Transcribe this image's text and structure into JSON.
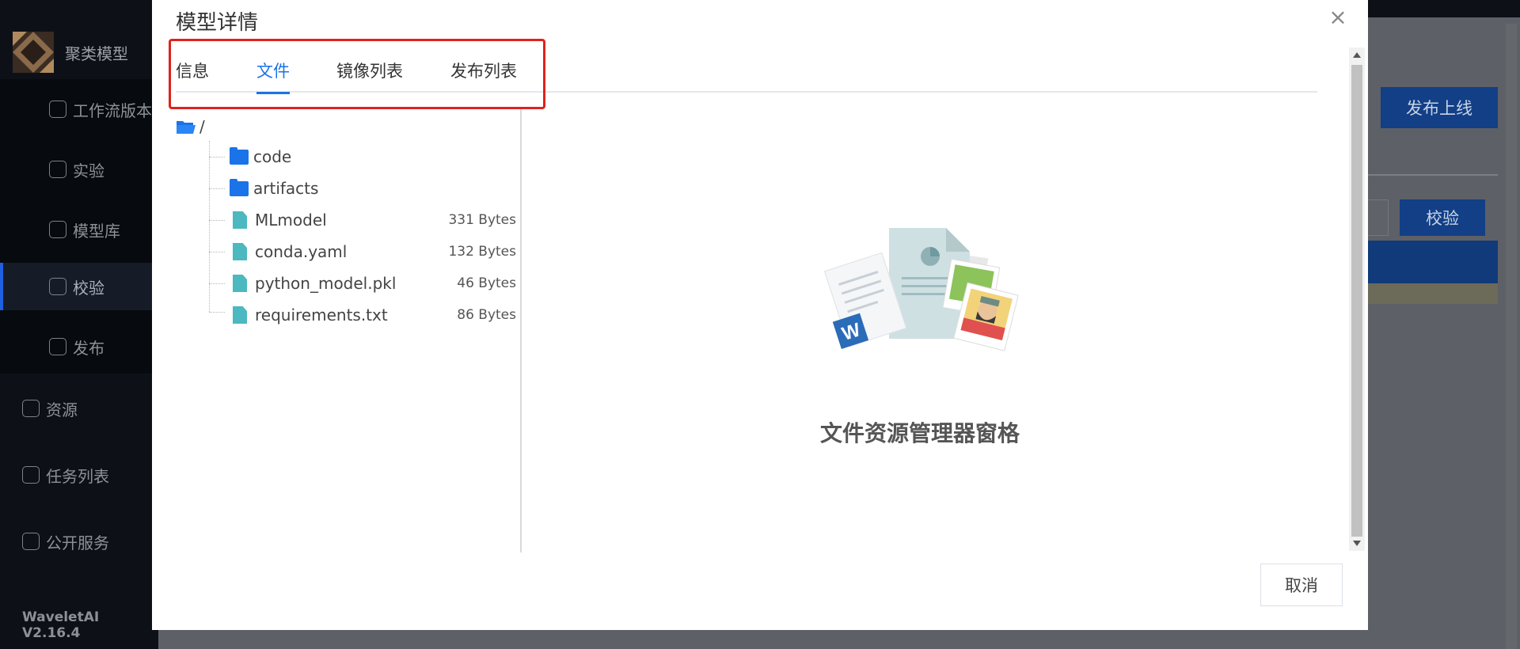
{
  "background": {
    "app_title": "聚类模型",
    "nav_sub": [
      {
        "label": "工作流版本",
        "icon": "workflow-icon"
      },
      {
        "label": "实验",
        "icon": "experiment-icon"
      },
      {
        "label": "模型库",
        "icon": "model-library-icon"
      },
      {
        "label": "校验",
        "icon": "scan-icon",
        "active": true
      },
      {
        "label": "发布",
        "icon": "cube-icon"
      }
    ],
    "nav_top": [
      {
        "label": "资源",
        "icon": "cloud-icon"
      },
      {
        "label": "任务列表",
        "icon": "share-icon"
      },
      {
        "label": "公开服务",
        "icon": "store-icon"
      }
    ],
    "version": "WaveletAI V2.16.4",
    "publish_button": "发布上线",
    "verify_button": "校验"
  },
  "modal": {
    "title": "模型详情",
    "close": "×",
    "tabs": [
      "信息",
      "文件",
      "镜像列表",
      "发布列表"
    ],
    "active_tab": "文件",
    "tree": {
      "root": "/",
      "items": [
        {
          "type": "folder",
          "name": "code",
          "size": ""
        },
        {
          "type": "folder",
          "name": "artifacts",
          "size": ""
        },
        {
          "type": "file",
          "name": "MLmodel",
          "size": "331 Bytes"
        },
        {
          "type": "file",
          "name": "conda.yaml",
          "size": "132 Bytes"
        },
        {
          "type": "file",
          "name": "python_model.pkl",
          "size": "46 Bytes"
        },
        {
          "type": "file",
          "name": "requirements.txt",
          "size": "86 Bytes"
        }
      ]
    },
    "preview_caption": "文件资源管理器窗格",
    "cancel_button": "取消"
  },
  "colors": {
    "accent": "#1a73e8",
    "highlight": "#e0221c",
    "file_icon": "#4cb8bf"
  }
}
